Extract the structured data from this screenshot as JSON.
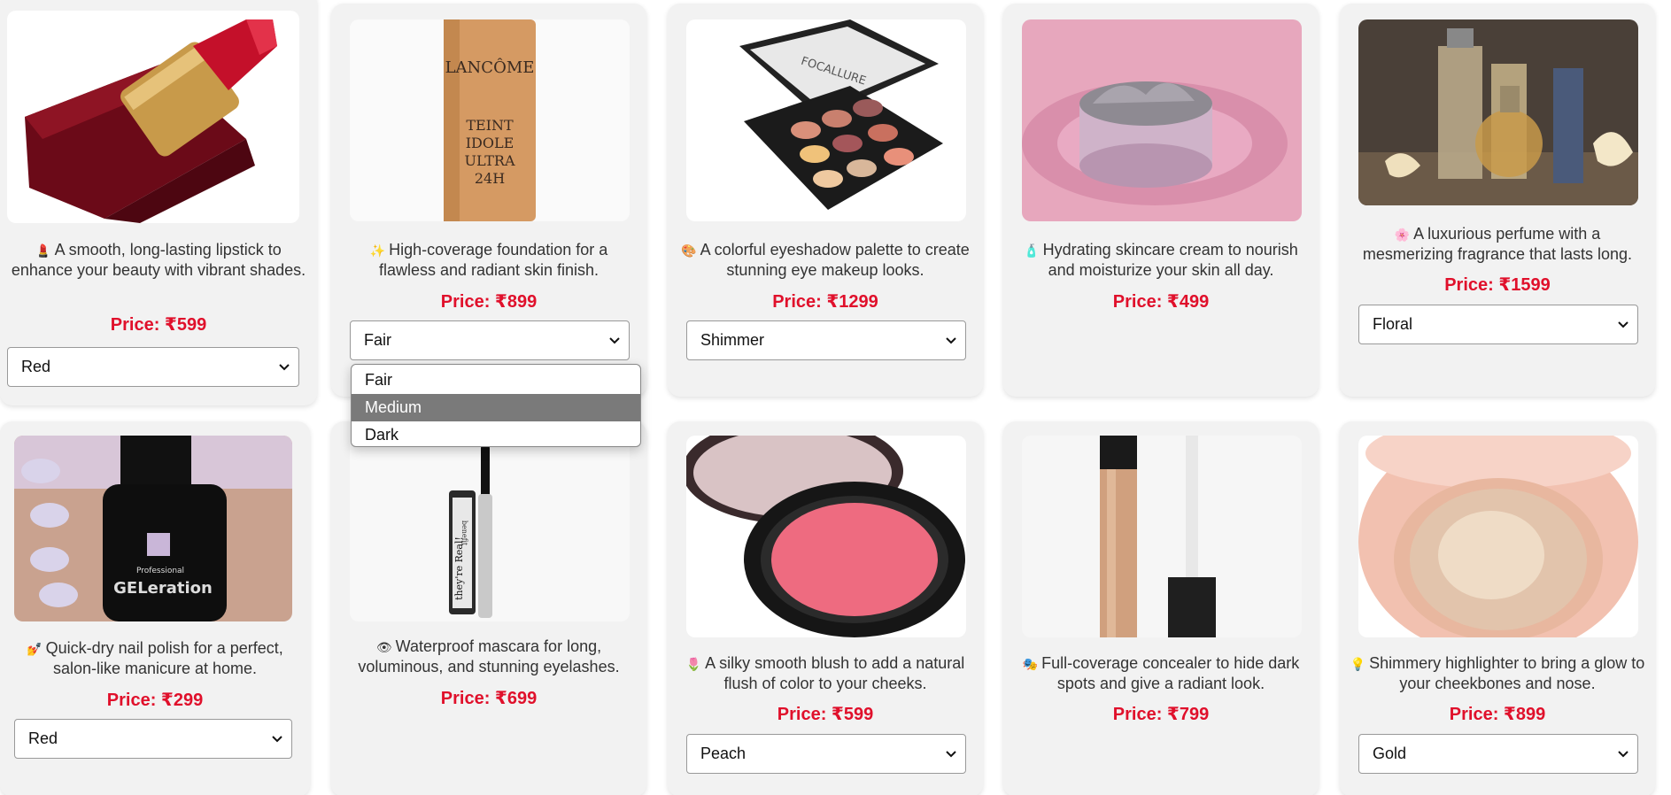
{
  "products": [
    {
      "emoji": "💄",
      "description": "A smooth, long-lasting lipstick to enhance your beauty with vibrant shades.",
      "price": "Price: ₹599",
      "selected_option": "Red",
      "image": "lipstick"
    },
    {
      "emoji": "✨",
      "description": "High-coverage foundation for a flawless and radiant skin finish.",
      "price": "Price: ₹899",
      "selected_option": "Fair",
      "image": "foundation",
      "image_text": [
        "LANCÔME",
        "TEINT",
        "IDOLE",
        "ULTRA",
        "24H"
      ]
    },
    {
      "emoji": "🎨",
      "description": "A colorful eyeshadow palette to create stunning eye makeup looks.",
      "price": "Price: ₹1299",
      "selected_option": "Shimmer",
      "image": "eyeshadow",
      "image_text": [
        "FOCALLURE"
      ]
    },
    {
      "emoji": "🧴",
      "description": "Hydrating skincare cream to nourish and moisturize your skin all day.",
      "price": "Price: ₹499",
      "selected_option": null,
      "image": "cream"
    },
    {
      "emoji": "🌸",
      "description": "A luxurious perfume with a mesmerizing fragrance that lasts long.",
      "price": "Price: ₹1599",
      "selected_option": "Floral",
      "image": "perfume"
    },
    {
      "emoji": "💅",
      "description": "Quick-dry nail polish for a perfect, salon-like manicure at home.",
      "price": "Price: ₹299",
      "selected_option": "Red",
      "image": "nail-polish",
      "image_text": [
        "Professional",
        "GELeration"
      ]
    },
    {
      "emoji": "👁",
      "description": "Waterproof mascara for long, voluminous, and stunning eyelashes.",
      "price": "Price: ₹699",
      "selected_option": null,
      "image": "mascara",
      "image_text": [
        "benefit",
        "they're Real!"
      ]
    },
    {
      "emoji": "🌷",
      "description": "A silky smooth blush to add a natural flush of color to your cheeks.",
      "price": "Price: ₹599",
      "selected_option": "Peach",
      "image": "blush"
    },
    {
      "emoji": "🎭",
      "description": "Full-coverage concealer to hide dark spots and give a radiant look.",
      "price": "Price: ₹799",
      "selected_option": null,
      "image": "concealer"
    },
    {
      "emoji": "💡",
      "description": "Shimmery highlighter to bring a glow to your cheekbones and nose.",
      "price": "Price: ₹899",
      "selected_option": "Gold",
      "image": "highlighter"
    }
  ],
  "open_dropdown": {
    "options": [
      "Fair",
      "Medium",
      "Dark"
    ],
    "highlighted": "Medium"
  },
  "colors": {
    "price": "#e0102b",
    "card_bg": "#f2f2f2",
    "highlight_bg": "#7a7a7a"
  }
}
